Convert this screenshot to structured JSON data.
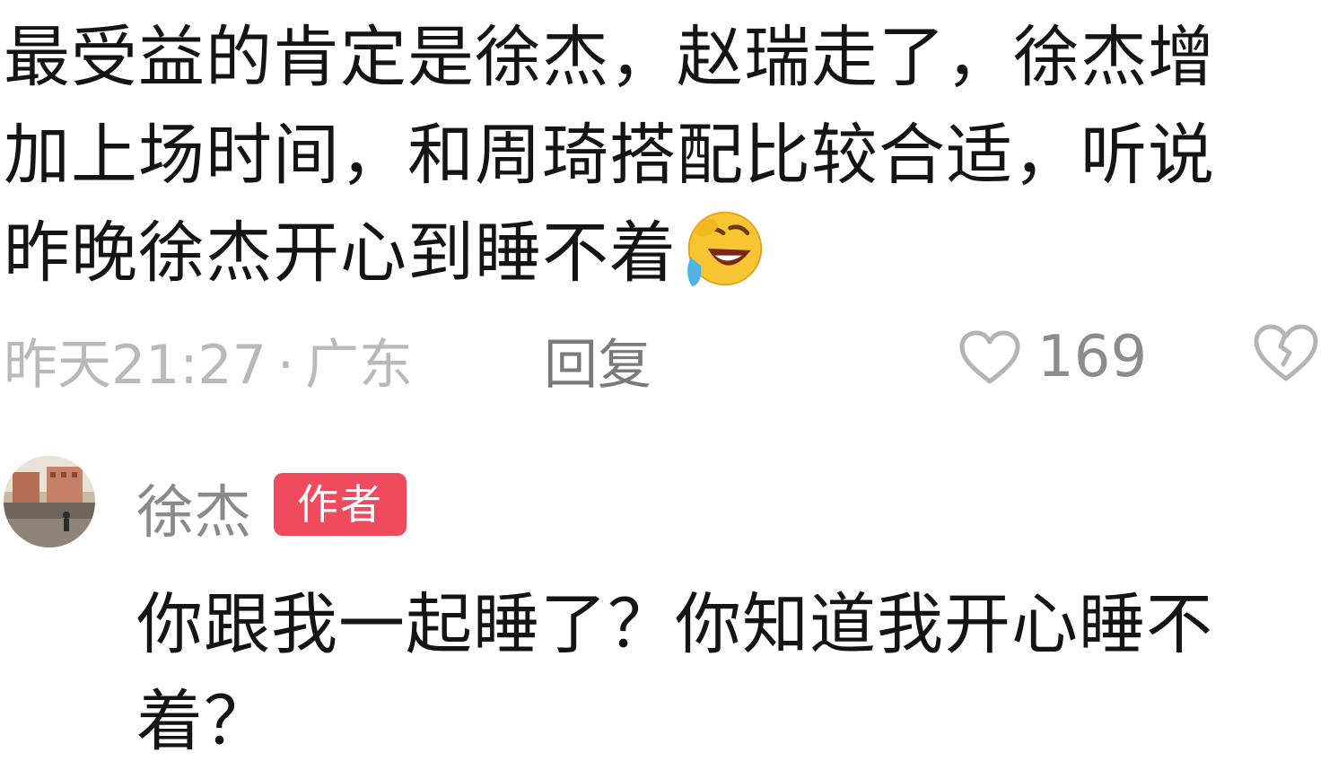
{
  "comment": {
    "lines": [
      "最受益的肯定是徐杰，赵瑞走了，徐杰增",
      "加上场时间，和周琦搭配比较合适，听说",
      "昨晚徐杰开心到睡不着"
    ],
    "emoji": "rolling-on-floor-laughing-emoji",
    "time": "昨天21:27",
    "separator": "·",
    "location": "广东",
    "reply_label": "回复",
    "like_count": "169"
  },
  "author_reply": {
    "name": "徐杰",
    "badge": "作者",
    "lines": [
      "你跟我一起睡了？你知道我开心睡不",
      "着？"
    ]
  },
  "colors": {
    "text": "#141414",
    "meta": "#b9b9b9",
    "badge_bg": "#f04a5e",
    "emoji_face": "#f7c531"
  }
}
